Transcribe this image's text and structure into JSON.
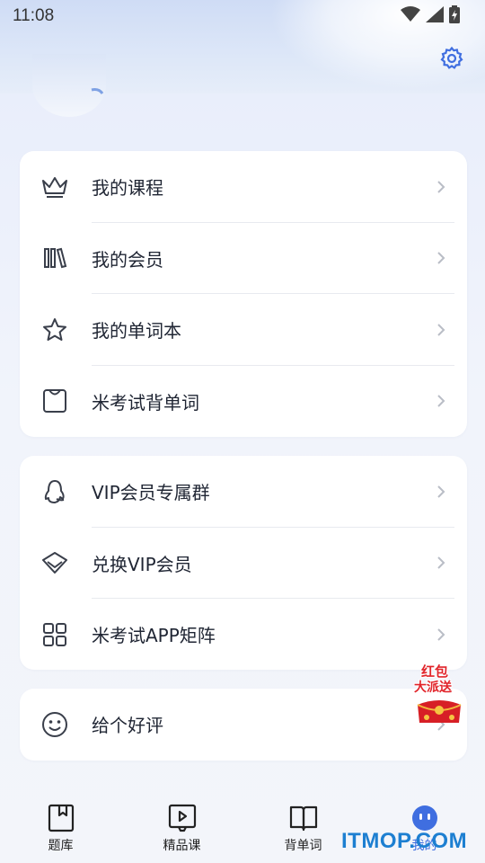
{
  "status_bar": {
    "time": "11:08"
  },
  "menu_group_1": [
    {
      "label": "我的课程",
      "icon": "crown-icon"
    },
    {
      "label": "我的会员",
      "icon": "books-icon"
    },
    {
      "label": "我的单词本",
      "icon": "star-icon"
    },
    {
      "label": "米考试背单词",
      "icon": "bag-icon"
    }
  ],
  "menu_group_2": [
    {
      "label": "VIP会员专属群",
      "icon": "qq-penguin-icon"
    },
    {
      "label": "兑换VIP会员",
      "icon": "diamond-icon"
    },
    {
      "label": "米考试APP矩阵",
      "icon": "grid-icon"
    }
  ],
  "menu_group_3": [
    {
      "label": "给个好评",
      "icon": "smile-icon"
    }
  ],
  "red_packet": {
    "line1": "红包",
    "line2": "大派送"
  },
  "bottom_nav": [
    {
      "label": "题库",
      "icon": "bookmark-book-icon",
      "active": false
    },
    {
      "label": "精品课",
      "icon": "video-play-icon",
      "active": false
    },
    {
      "label": "背单词",
      "icon": "open-book-icon",
      "active": false
    },
    {
      "label": "我的",
      "icon": "profile-face-icon",
      "active": true
    }
  ],
  "watermark": "ITMOP.COM",
  "colors": {
    "accent": "#3f6ee0",
    "card_bg": "#ffffff",
    "page_bg": "#eef1fb"
  }
}
